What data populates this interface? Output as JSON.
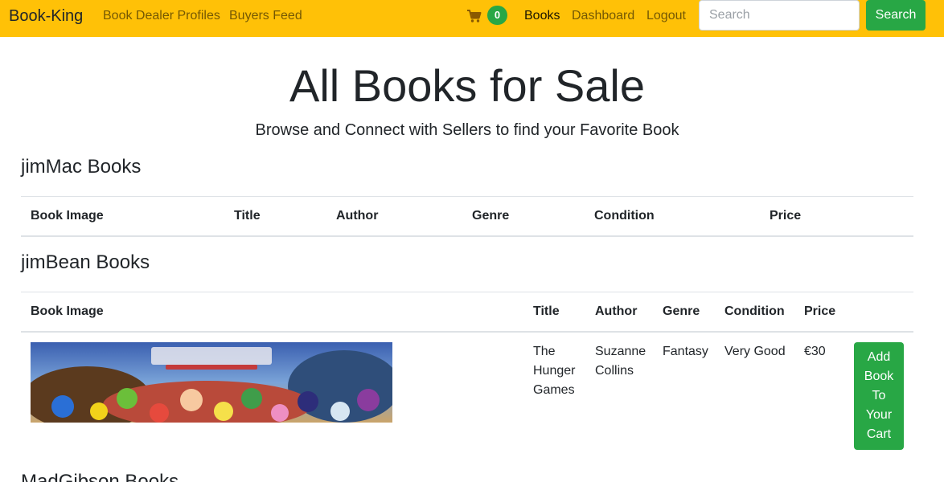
{
  "navbar": {
    "brand": "Book-King",
    "links": [
      {
        "label": "Book Dealer Profiles"
      },
      {
        "label": "Buyers Feed"
      }
    ],
    "cart_count": "0",
    "right_links": [
      {
        "label": "Books"
      },
      {
        "label": "Dashboard"
      },
      {
        "label": "Logout"
      }
    ],
    "search_placeholder": "Search",
    "search_button": "Search"
  },
  "header": {
    "title": "All Books for Sale",
    "subtitle": "Browse and Connect with Sellers to find your Favorite Book"
  },
  "columns": [
    "Book Image",
    "Title",
    "Author",
    "Genre",
    "Condition",
    "Price"
  ],
  "sections": [
    {
      "title": "jimMac Books",
      "rows": []
    },
    {
      "title": "jimBean Books",
      "rows": [
        {
          "title": "The Hunger Games",
          "title_lines": [
            "The",
            "Hunger",
            "Games"
          ],
          "author_lines": [
            "Suzanne",
            "Collins"
          ],
          "genre": "Fantasy",
          "condition": "Very Good",
          "price": "€30",
          "button_lines": [
            "Add",
            "Book",
            "To",
            "Your",
            "Cart"
          ]
        }
      ]
    },
    {
      "title": "MadGibson Books"
    }
  ],
  "colors": {
    "navbar": "#ffc107",
    "success": "#28a745",
    "border": "#dee2e6"
  }
}
